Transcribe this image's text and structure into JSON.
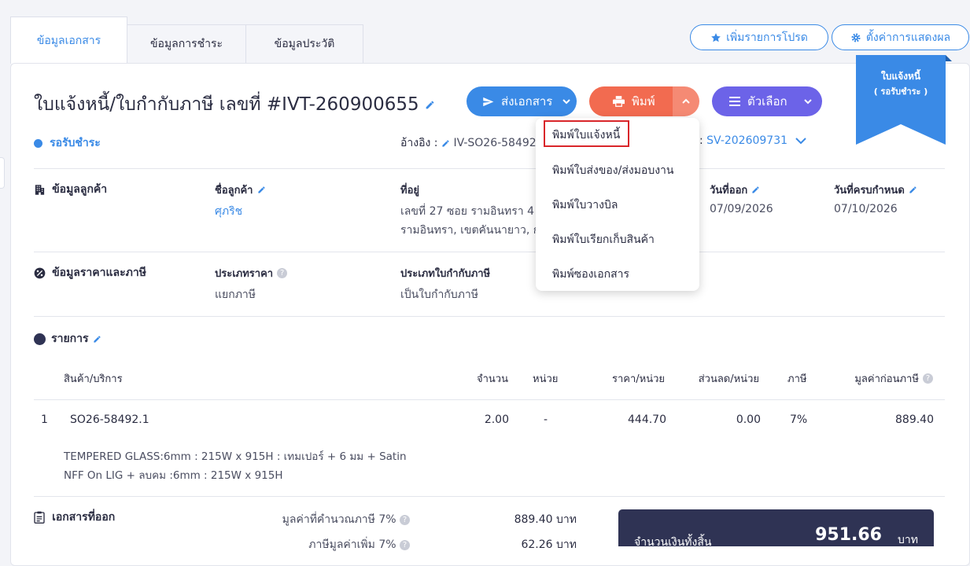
{
  "tabs": [
    "ข้อมูลเอกสาร",
    "ข้อมูลการชำระ",
    "ข้อมูลประวัติ"
  ],
  "top_actions": {
    "favorite": "เพิ่มรายการโปรด",
    "display_settings": "ตั้งค่าการแสดงผล"
  },
  "ribbon": {
    "line1": "ใบแจ้งหนี้",
    "line2": "( รอรับชำระ )"
  },
  "doc": {
    "title": "ใบแจ้งหนี้/ใบกำกับภาษี เลขที่ #IVT-260900655",
    "status": "รอรับชำระ",
    "reference_label": "อ้างอิง :",
    "reference_value": "IV-SO26-58492",
    "reference2_value": "SV-202609731",
    "status_color": "#3a8ae6"
  },
  "buttons": {
    "send": "ส่งเอกสาร",
    "print": "พิมพ์",
    "options": "ตัวเลือก"
  },
  "print_menu": [
    "พิมพ์ใบแจ้งหนี้",
    "พิมพ์ใบส่งของ/ส่งมอบงาน",
    "พิมพ์ใบวางบิล",
    "พิมพ์ใบเรียกเก็บสินค้า",
    "พิมพ์ซองเอกสาร"
  ],
  "customer": {
    "section": "ข้อมูลลูกค้า",
    "name_label": "ชื่อลูกค้า",
    "name": "ศุภริช",
    "address_label": "ที่อยู่",
    "address_line1": "เลขที่ 27 ซอย รามอินทรา 4",
    "address_line2": "รามอินทรา, เขตคันนายาว, ก",
    "issue_label": "วันที่ออก",
    "issue_date": "07/09/2026",
    "due_label": "วันที่ครบกำหนด",
    "due_date": "07/10/2026"
  },
  "pricing": {
    "section": "ข้อมูลราคาและภาษี",
    "price_type_label": "ประเภทราคา",
    "price_type": "แยกภาษี",
    "tax_doc_label": "ประเภทใบกำกับภาษี",
    "tax_doc": "เป็นใบกำกับภาษี"
  },
  "items": {
    "section": "รายการ",
    "headers": [
      "สินค้า/บริการ",
      "จำนวน",
      "หน่วย",
      "ราคา/หน่วย",
      "ส่วนลด/หน่วย",
      "ภาษี",
      "มูลค่าก่อนภาษี"
    ],
    "rows": [
      {
        "no": "1",
        "code": "SO26-58492.1",
        "qty": "2.00",
        "unit": "-",
        "price": "444.70",
        "discount": "0.00",
        "tax": "7%",
        "amount": "889.40",
        "desc1": "TEMPERED GLASS:6mm : 215W x 915H : เทมเปอร์ + 6 มม + Satin",
        "desc2": "NFF On LIG + ลบคม :6mm : 215W x 915H"
      }
    ]
  },
  "footer": {
    "docs_section": "เอกสารที่ออก",
    "taxable_label": "มูลค่าที่คำนวณภาษี 7%",
    "taxable_value": "889.40 บาท",
    "vat_label": "ภาษีมูลค่าเพิ่ม 7%",
    "vat_value": "62.26 บาท",
    "total_label": "จำนวนเงินทั้งสิ้น",
    "total_value": "951.66",
    "total_unit": "บาท"
  },
  "colors": {
    "accent": "#3a8ae6",
    "print": "#f26b50",
    "options": "#6c63e8",
    "total_bg": "#2f3354",
    "highlight": "#d9262a"
  }
}
